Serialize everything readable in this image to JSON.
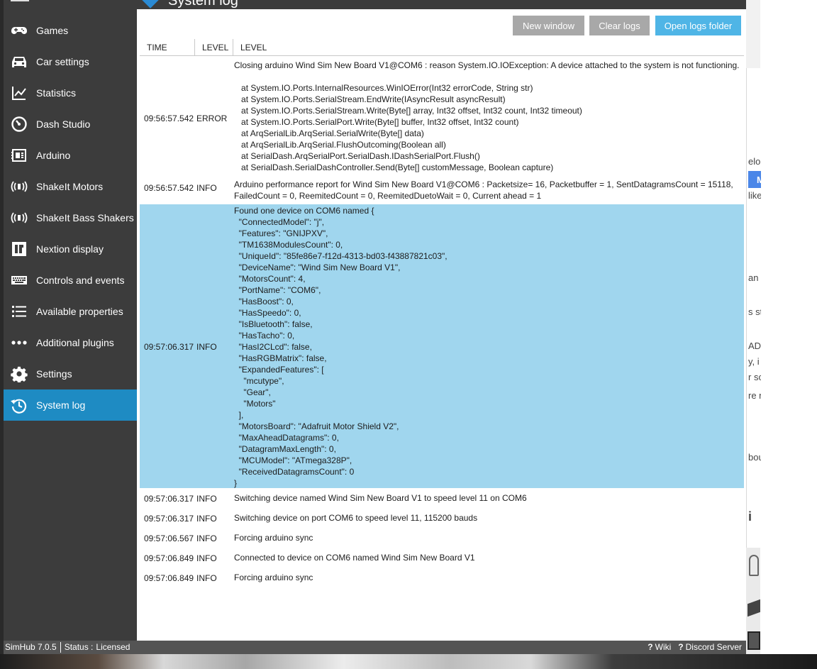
{
  "app": {
    "title": "System log",
    "version": "SimHub 7.0.5",
    "status_label": "Status :",
    "status_value": "Licensed"
  },
  "sidebar": {
    "items": [
      {
        "label": "Games",
        "icon": "gamepad-icon"
      },
      {
        "label": "Car settings",
        "icon": "car-icon"
      },
      {
        "label": "Statistics",
        "icon": "chart-line-icon"
      },
      {
        "label": "Dash Studio",
        "icon": "gauge-icon"
      },
      {
        "label": "Arduino",
        "icon": "arduino-icon"
      },
      {
        "label": "ShakeIt Motors",
        "icon": "vibration-icon"
      },
      {
        "label": "ShakeIt Bass Shakers",
        "icon": "vibration-icon"
      },
      {
        "label": "Nextion display",
        "icon": "nextion-icon"
      },
      {
        "label": "Controls and events",
        "icon": "keyboard-icon"
      },
      {
        "label": "Available properties",
        "icon": "list-icon"
      },
      {
        "label": "Additional plugins",
        "icon": "dots-icon"
      },
      {
        "label": "Settings",
        "icon": "gear-icon"
      },
      {
        "label": "System log",
        "icon": "history-icon",
        "active": true
      }
    ]
  },
  "toolbar": {
    "new_window": "New window",
    "clear_logs": "Clear logs",
    "open_logs_folder": "Open logs folder"
  },
  "grid": {
    "columns": [
      "TIME",
      "LEVEL",
      "LEVEL"
    ],
    "rows": [
      {
        "time": "09:56:57.542",
        "level": "ERROR",
        "message": "Closing arduino Wind Sim New Board V1@COM6 : reason System.IO.IOException: A device attached to the system is not functioning.\n\n   at System.IO.Ports.InternalResources.WinIOError(Int32 errorCode, String str)\n   at System.IO.Ports.SerialStream.EndWrite(IAsyncResult asyncResult)\n   at System.IO.Ports.SerialStream.Write(Byte[] array, Int32 offset, Int32 count, Int32 timeout)\n   at System.IO.Ports.SerialPort.Write(Byte[] buffer, Int32 offset, Int32 count)\n   at ArqSerialLib.ArqSerial.SerialWrite(Byte[] data)\n   at ArqSerialLib.ArqSerial.FlushOutcoming(Boolean all)\n   at SerialDash.ArqSerialPort.SerialDash.IDashSerialPort.Flush()\n   at SerialDash.SerialDashController.Send(Byte[] customMessage, Boolean capture)"
      },
      {
        "time": "09:56:57.542",
        "level": "INFO",
        "message": "Arduino performance report for Wind Sim New Board V1@COM6 : Packetsize= 16, Packetbuffer = 1, SentDatagramsCount = 15118,\nFailedCount = 0, ReemitedCount = 0, ReemitedDuetoWait = 0, Current ahead = 1"
      },
      {
        "time": "09:57:06.317",
        "level": "INFO",
        "message": "Found one device on COM6 named {\n  \"ConnectedModel\": \"j\",\n  \"Features\": \"GNIJPXV\",\n  \"TM1638ModulesCount\": 0,\n  \"UniqueId\": \"85fe86e7-f12d-4313-bd03-f43887821c03\",\n  \"DeviceName\": \"Wind Sim New Board V1\",\n  \"MotorsCount\": 4,\n  \"PortName\": \"COM6\",\n  \"HasBoost\": 0,\n  \"HasSpeedo\": 0,\n  \"IsBluetooth\": false,\n  \"HasTacho\": 0,\n  \"HasI2CLcd\": false,\n  \"HasRGBMatrix\": false,\n  \"ExpandedFeatures\": [\n    \"mcutype\",\n    \"Gear\",\n    \"Motors\"\n  ],\n  \"MotorsBoard\": \"Adafruit Motor Shield V2\",\n  \"MaxAheadDatagrams\": 0,\n  \"DatagramMaxLength\": 0,\n  \"MCUModel\": \"ATmega328P\",\n  \"ReceivedDatagramsCount\": 0\n}",
        "selected": true
      },
      {
        "time": "09:57:06.317",
        "level": "INFO",
        "message": "Switching device named Wind Sim New Board V1 to speed level 11 on COM6"
      },
      {
        "time": "09:57:06.317",
        "level": "INFO",
        "message": "Switching device on port COM6 to speed level 11, 115200 bauds"
      },
      {
        "time": "09:57:06.567",
        "level": "INFO",
        "message": "Forcing arduino sync"
      },
      {
        "time": "09:57:06.849",
        "level": "INFO",
        "message": "Connected to device on COM6 named Wind Sim New Board V1"
      },
      {
        "time": "09:57:06.849",
        "level": "INFO",
        "message": "Forcing arduino sync"
      }
    ]
  },
  "statusbar": {
    "wiki": "Wiki",
    "discord": "Discord Server"
  },
  "desktop_fragments": [
    "M",
    "elo",
    "like",
    "an",
    "s st",
    "AD",
    "y, i",
    "r sc",
    "re n",
    "bou",
    "i"
  ]
}
